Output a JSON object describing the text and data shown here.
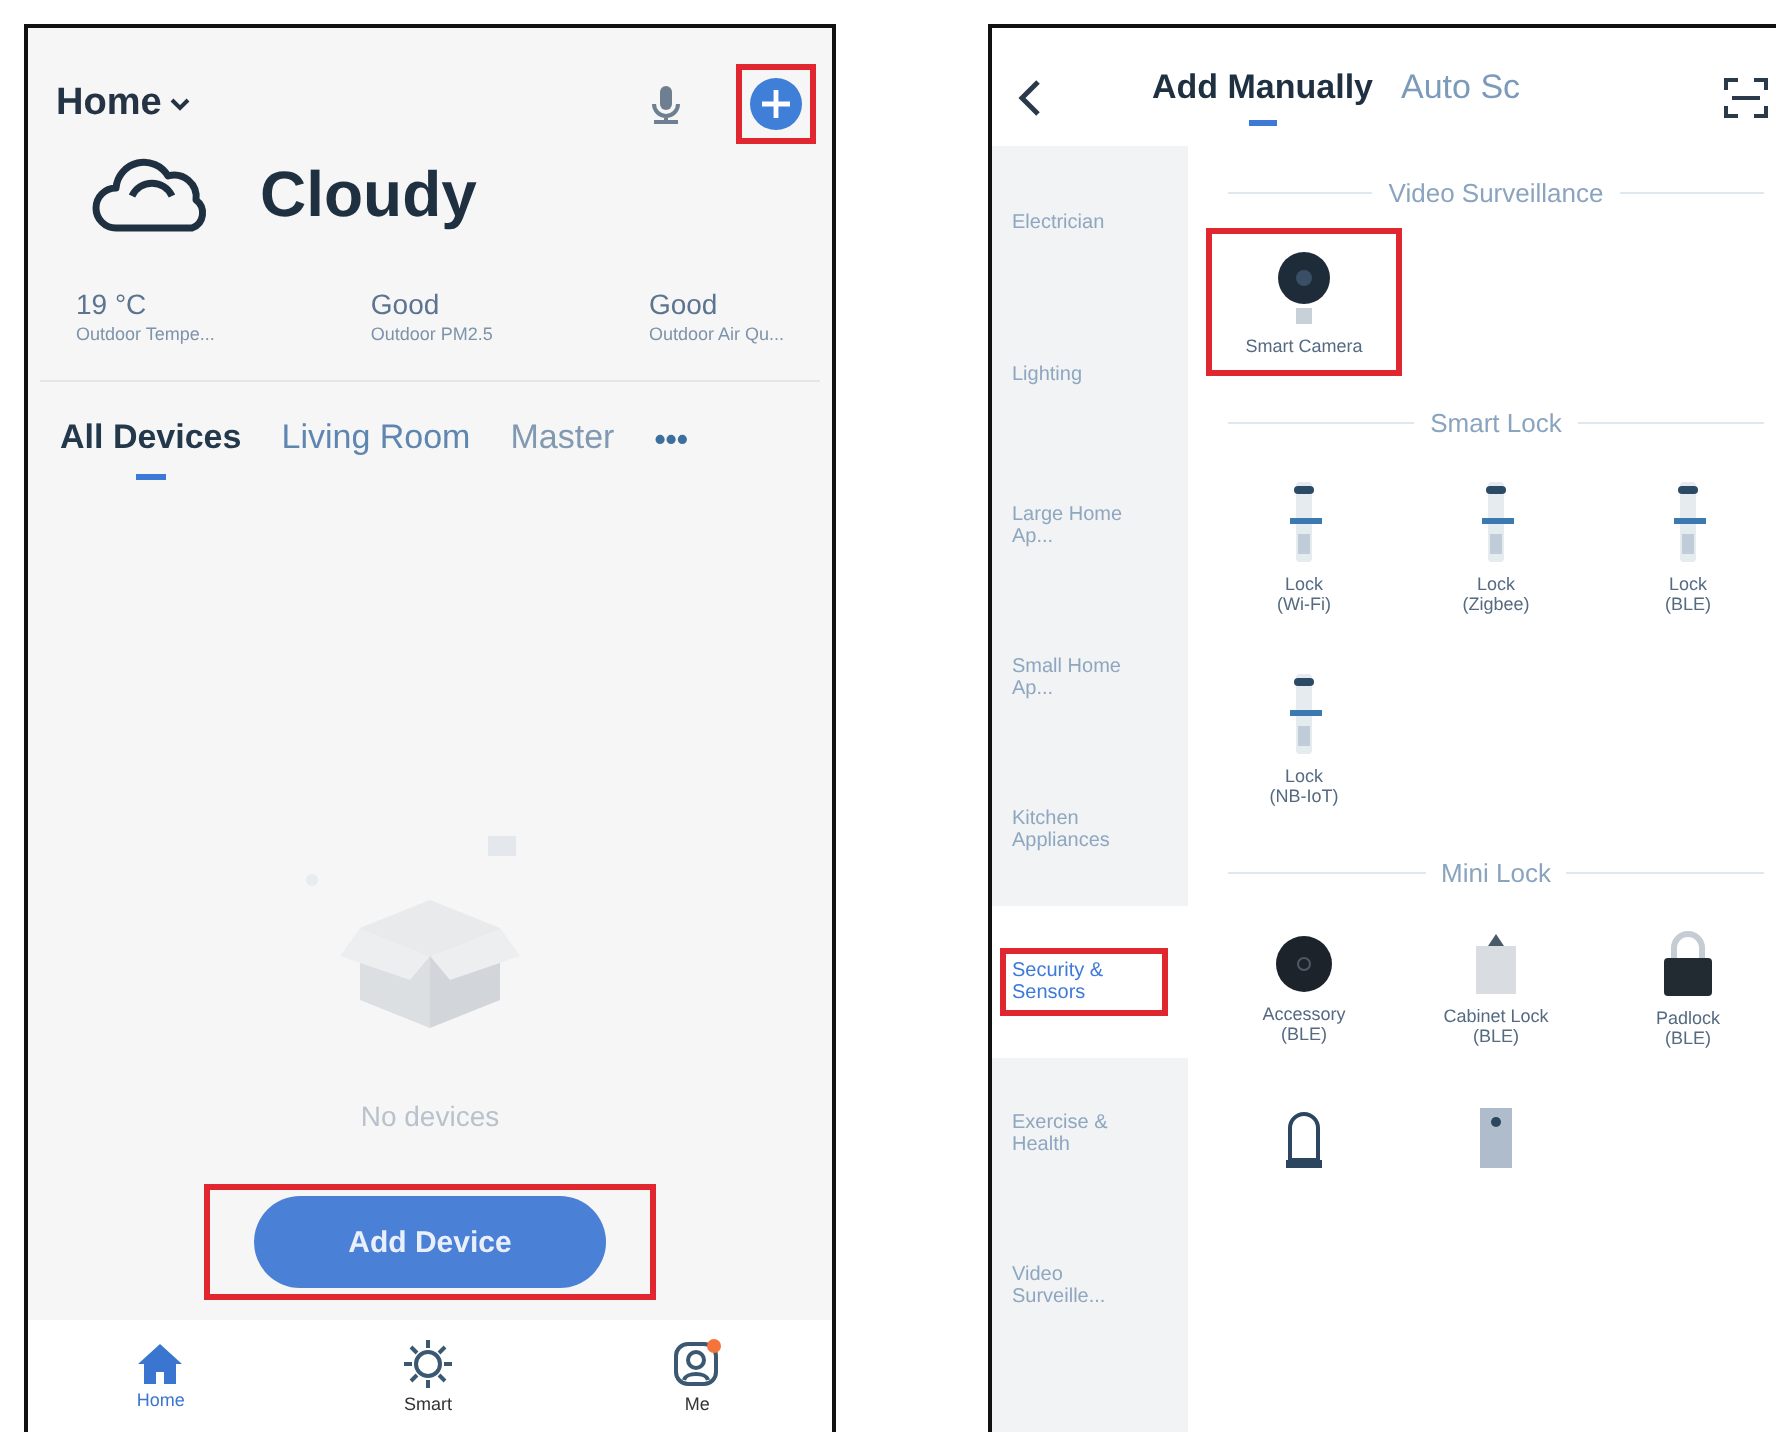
{
  "left_screen": {
    "home_selector": {
      "label": "Home"
    },
    "add_icon_button": {
      "highlighted": true
    },
    "weather": {
      "condition": "Cloudy",
      "stats": [
        {
          "value": "19 °C",
          "label": "Outdoor Tempe..."
        },
        {
          "value": "Good",
          "label": "Outdoor PM2.5"
        },
        {
          "value": "Good",
          "label": "Outdoor Air Qu..."
        }
      ]
    },
    "room_tabs": [
      {
        "label": "All Devices",
        "selected": true
      },
      {
        "label": "Living Room",
        "selected": false
      },
      {
        "label": "Master",
        "selected": false
      }
    ],
    "more_tabs": "•••",
    "empty_state": {
      "message": "No devices"
    },
    "add_device_button": {
      "label": "Add Device",
      "highlighted": true
    },
    "bottom_nav": [
      {
        "label": "Home",
        "selected": true
      },
      {
        "label": "Smart",
        "selected": false
      },
      {
        "label": "Me",
        "selected": false,
        "badge": true
      }
    ]
  },
  "right_screen": {
    "mode_tabs": [
      {
        "label": "Add Manually",
        "selected": true
      },
      {
        "label": "Auto Sc",
        "selected": false
      }
    ],
    "categories": [
      {
        "label": "Electrician",
        "selected": false,
        "highlighted": false
      },
      {
        "label": "Lighting",
        "selected": false,
        "highlighted": false
      },
      {
        "label": "Large Home Ap...",
        "selected": false,
        "highlighted": false
      },
      {
        "label": "Small Home Ap...",
        "selected": false,
        "highlighted": false
      },
      {
        "label": "Kitchen Appliances",
        "selected": false,
        "highlighted": false
      },
      {
        "label": "Security & Sensors",
        "selected": true,
        "highlighted": true
      },
      {
        "label": "Exercise & Health",
        "selected": false,
        "highlighted": false
      },
      {
        "label": "Video Surveille...",
        "selected": false,
        "highlighted": false
      }
    ],
    "sections": [
      {
        "title": "Video Surveillance",
        "items": [
          {
            "kind": "camera",
            "label": "Smart Camera",
            "highlighted": true
          }
        ]
      },
      {
        "title": "Smart Lock",
        "items": [
          {
            "kind": "lock",
            "label": "Lock\n(Wi-Fi)",
            "highlighted": false
          },
          {
            "kind": "lock",
            "label": "Lock\n(Zigbee)",
            "highlighted": false
          },
          {
            "kind": "lock",
            "label": "Lock\n(BLE)",
            "highlighted": false
          },
          {
            "kind": "lock",
            "label": "Lock\n(NB-IoT)",
            "highlighted": false
          }
        ]
      },
      {
        "title": "Mini Lock",
        "items": [
          {
            "kind": "accessory",
            "label": "Accessory\n(BLE)",
            "highlighted": false
          },
          {
            "kind": "cabinet",
            "label": "Cabinet Lock\n(BLE)",
            "highlighted": false
          },
          {
            "kind": "padlock",
            "label": "Padlock\n(BLE)",
            "highlighted": false
          },
          {
            "kind": "doorbell",
            "highlighted": false
          },
          {
            "kind": "keypad",
            "highlighted": false
          }
        ]
      }
    ]
  }
}
